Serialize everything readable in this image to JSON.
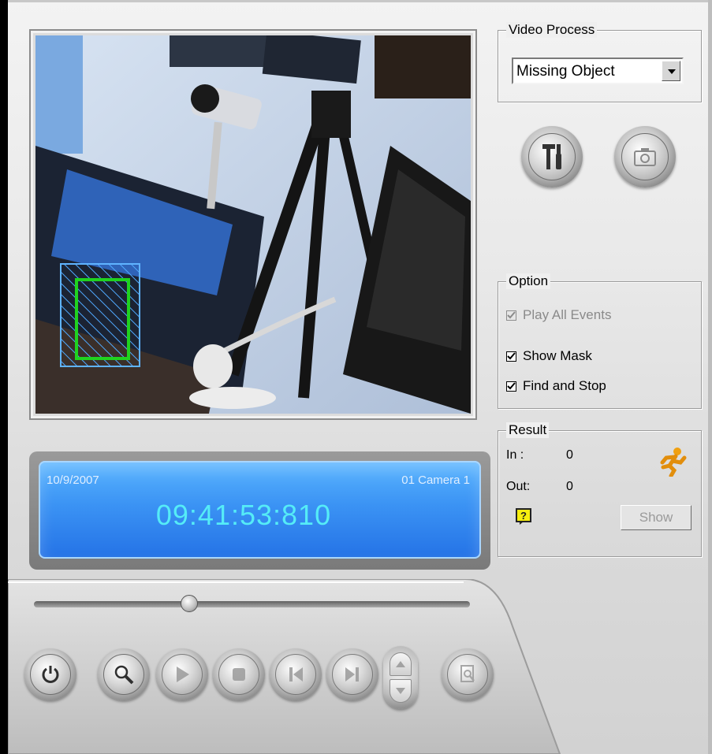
{
  "video_process": {
    "group_title": "Video Process",
    "selected": "Missing Object"
  },
  "tools": {
    "settings_icon": "hammer-screwdriver-icon",
    "snapshot_icon": "camera-icon"
  },
  "option": {
    "group_title": "Option",
    "play_all_events": {
      "label": "Play All Events",
      "checked": true,
      "enabled": false
    },
    "show_mask": {
      "label": "Show Mask",
      "checked": true
    },
    "find_and_stop": {
      "label": "Find and Stop",
      "checked": true
    }
  },
  "result": {
    "group_title": "Result",
    "in_label": "In :",
    "in_value": "0",
    "out_label": "Out:",
    "out_value": "0",
    "show_button": "Show"
  },
  "display": {
    "date": "10/9/2007",
    "camera": "01 Camera 1",
    "time": "09:41:53:810"
  },
  "playback": {
    "slider_position": 0.35
  },
  "colors": {
    "display_bg": "#3b93f4",
    "time_text": "#55ecf7",
    "mask_box": "#1fd21f",
    "hatch": "#5fb3ff"
  }
}
